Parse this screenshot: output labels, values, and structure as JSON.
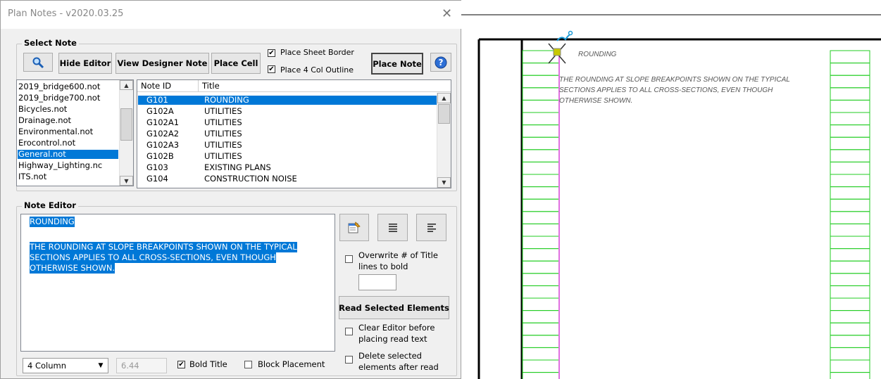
{
  "window": {
    "title": "Plan Notes - v2020.03.25",
    "close_glyph": "✕"
  },
  "select_note": {
    "group_label": "Select Note",
    "search_icon": "magnifier-icon",
    "hide_editor_label": "Hide Editor",
    "view_designer_label": "View Designer Note",
    "place_cell_label": "Place Cell",
    "place_sheet_border_label": "Place Sheet Border",
    "place_sheet_border_checked": true,
    "place_4col_label": "Place 4 Col Outline",
    "place_4col_checked": true,
    "place_note_label": "Place Note",
    "help_icon": "help-icon",
    "files": [
      {
        "name": "2019_bridge600.not",
        "selected": false
      },
      {
        "name": "2019_bridge700.not",
        "selected": false
      },
      {
        "name": "Bicycles.not",
        "selected": false
      },
      {
        "name": "Drainage.not",
        "selected": false
      },
      {
        "name": "Environmental.not",
        "selected": false
      },
      {
        "name": "Erocontrol.not",
        "selected": false
      },
      {
        "name": "General.not",
        "selected": true
      },
      {
        "name": "Highway_Lighting.nc",
        "selected": false
      },
      {
        "name": "ITS.not",
        "selected": false
      }
    ],
    "notes_columns": [
      "Note ID",
      "Title"
    ],
    "notes": [
      {
        "id": "G101",
        "title": "ROUNDING",
        "selected": true
      },
      {
        "id": "G102A",
        "title": "UTILITIES",
        "selected": false
      },
      {
        "id": "G102A1",
        "title": "UTILITIES",
        "selected": false
      },
      {
        "id": "G102A2",
        "title": "UTILITIES",
        "selected": false
      },
      {
        "id": "G102A3",
        "title": "UTILITIES",
        "selected": false
      },
      {
        "id": "G102B",
        "title": "UTILITIES",
        "selected": false
      },
      {
        "id": "G103",
        "title": "EXISTING PLANS",
        "selected": false
      },
      {
        "id": "G104",
        "title": "CONSTRUCTION NOISE",
        "selected": false
      }
    ]
  },
  "note_editor": {
    "group_label": "Note Editor",
    "lines": [
      "ROUNDING",
      " ",
      "THE ROUNDING AT SLOPE BREAKPOINTS SHOWN ON THE TYPICAL",
      "SECTIONS APPLIES TO ALL CROSS-SECTIONS, EVEN THOUGH",
      "OTHERWISE SHOWN."
    ],
    "properties_icon": "properties-icon",
    "justify_icon": "align-justify-icon",
    "left_align_icon": "align-left-icon",
    "overwrite_label_1": "Overwrite # of Title",
    "overwrite_label_2": "lines to bold",
    "overwrite_checked": false,
    "overwrite_value": "",
    "read_selected_label": "Read Selected Elements",
    "clear_editor_label_1": "Clear Editor before",
    "clear_editor_label_2": "placing read text",
    "clear_editor_checked": false,
    "delete_selected_label_1": "Delete selected",
    "delete_selected_label_2": "elements after read",
    "delete_selected_checked": false,
    "column_select_value": "4 Column",
    "width_value": "6.44",
    "bold_title_label": "Bold Title",
    "bold_title_checked": true,
    "block_placement_label": "Block Placement",
    "block_placement_checked": false
  },
  "drawing": {
    "text_lines": [
      "ROUNDING",
      "THE ROUNDING AT SLOPE BREAKPOINTS SHOWN ON THE TYPICAL",
      "SECTIONS APPLIES TO ALL CROSS-SECTIONS, EVEN THOUGH",
      "OTHERWISE SHOWN."
    ],
    "colors": {
      "border": "#000000",
      "grid": "#22cc22",
      "guide": "#e070e0",
      "cursor": "#c8c800"
    }
  }
}
